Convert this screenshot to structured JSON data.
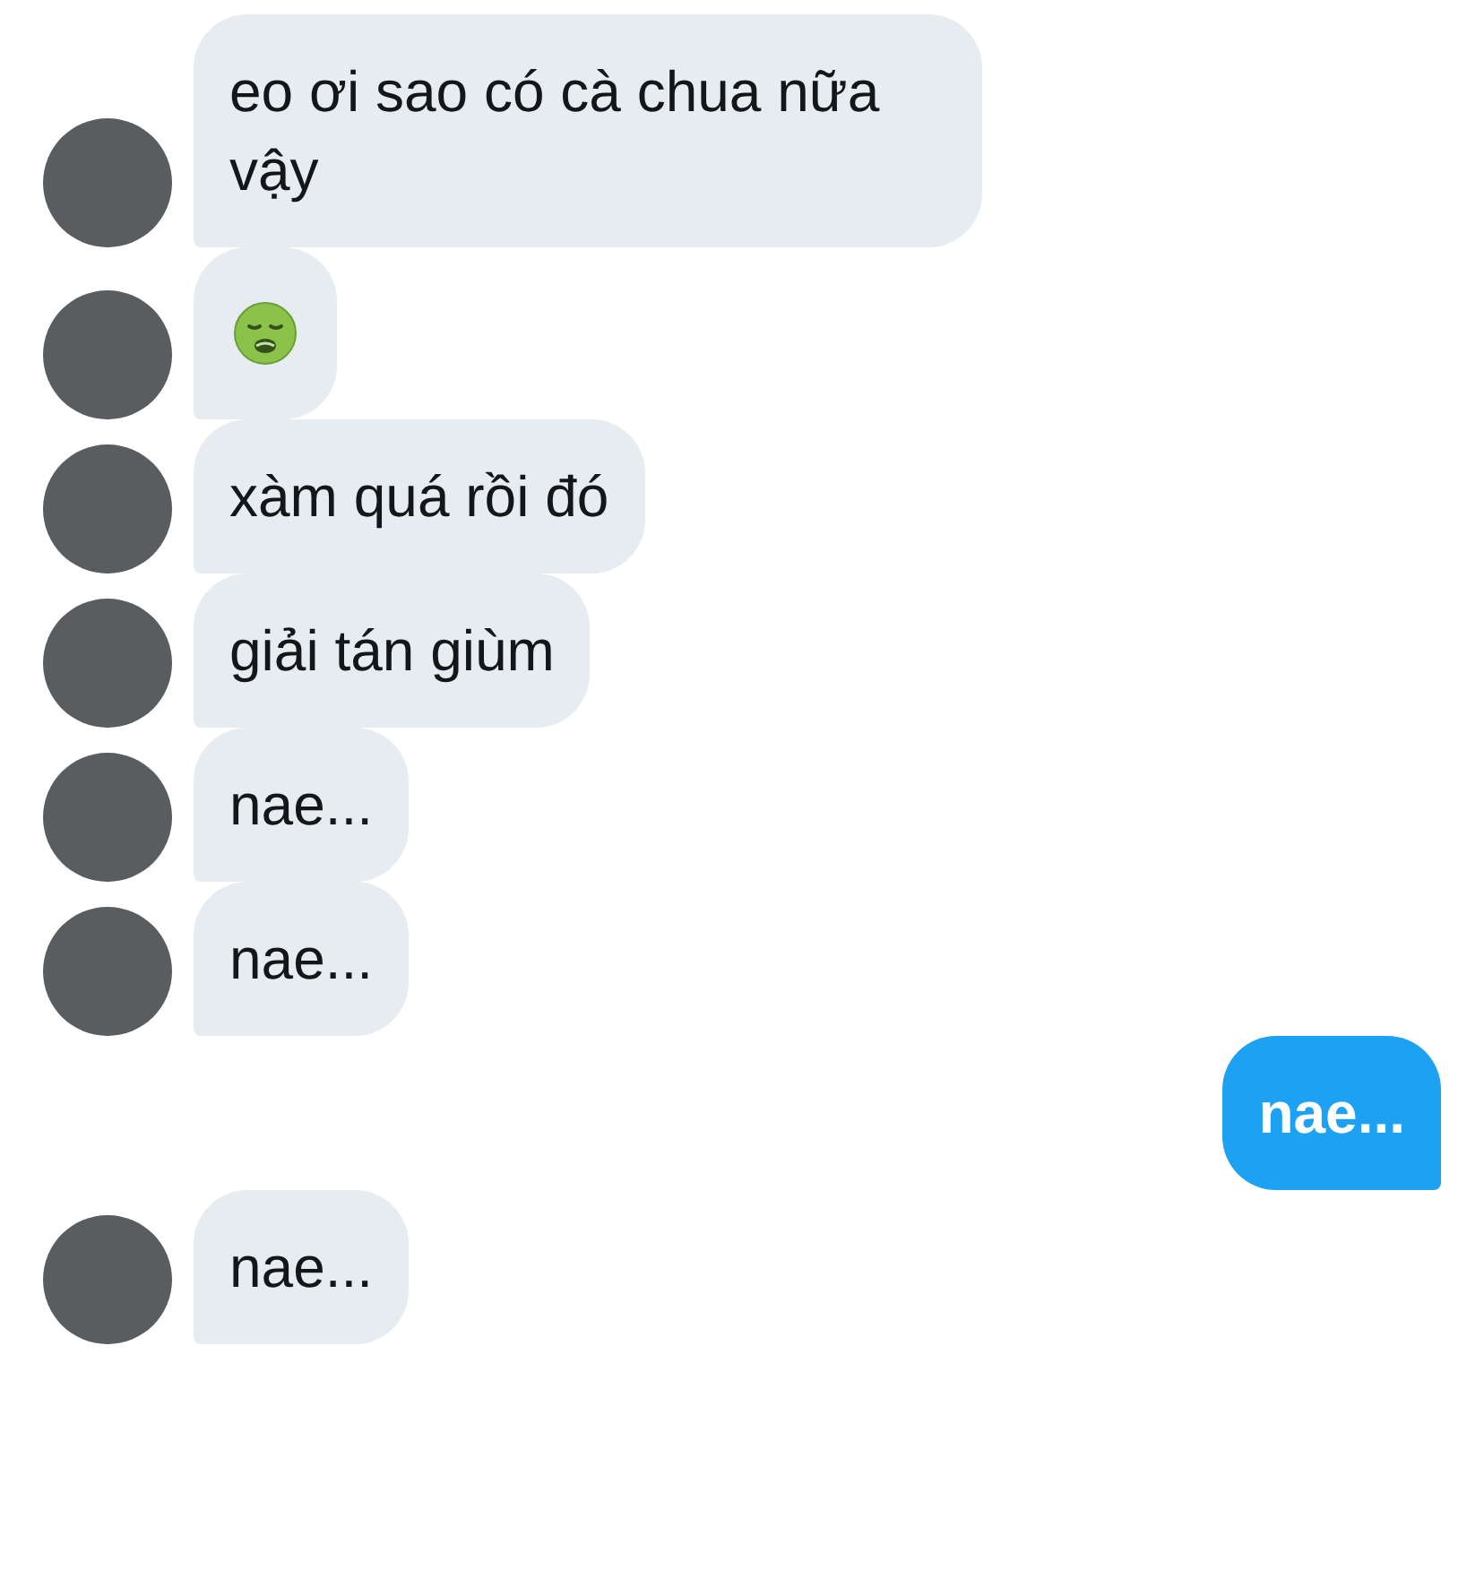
{
  "messages": [
    {
      "kind": "text",
      "sent": false,
      "text": "eo ơi sao có cà chua nữa vậy"
    },
    {
      "kind": "emoji",
      "sent": false
    },
    {
      "kind": "text",
      "sent": false,
      "text": "xàm quá rồi đó"
    },
    {
      "kind": "text",
      "sent": false,
      "text": "giải tán giùm"
    },
    {
      "kind": "text",
      "sent": false,
      "text": "nae..."
    },
    {
      "kind": "text",
      "sent": false,
      "text": "nae..."
    },
    {
      "kind": "text",
      "sent": true,
      "text": "nae..."
    },
    {
      "kind": "text",
      "sent": false,
      "text": "nae..."
    }
  ]
}
